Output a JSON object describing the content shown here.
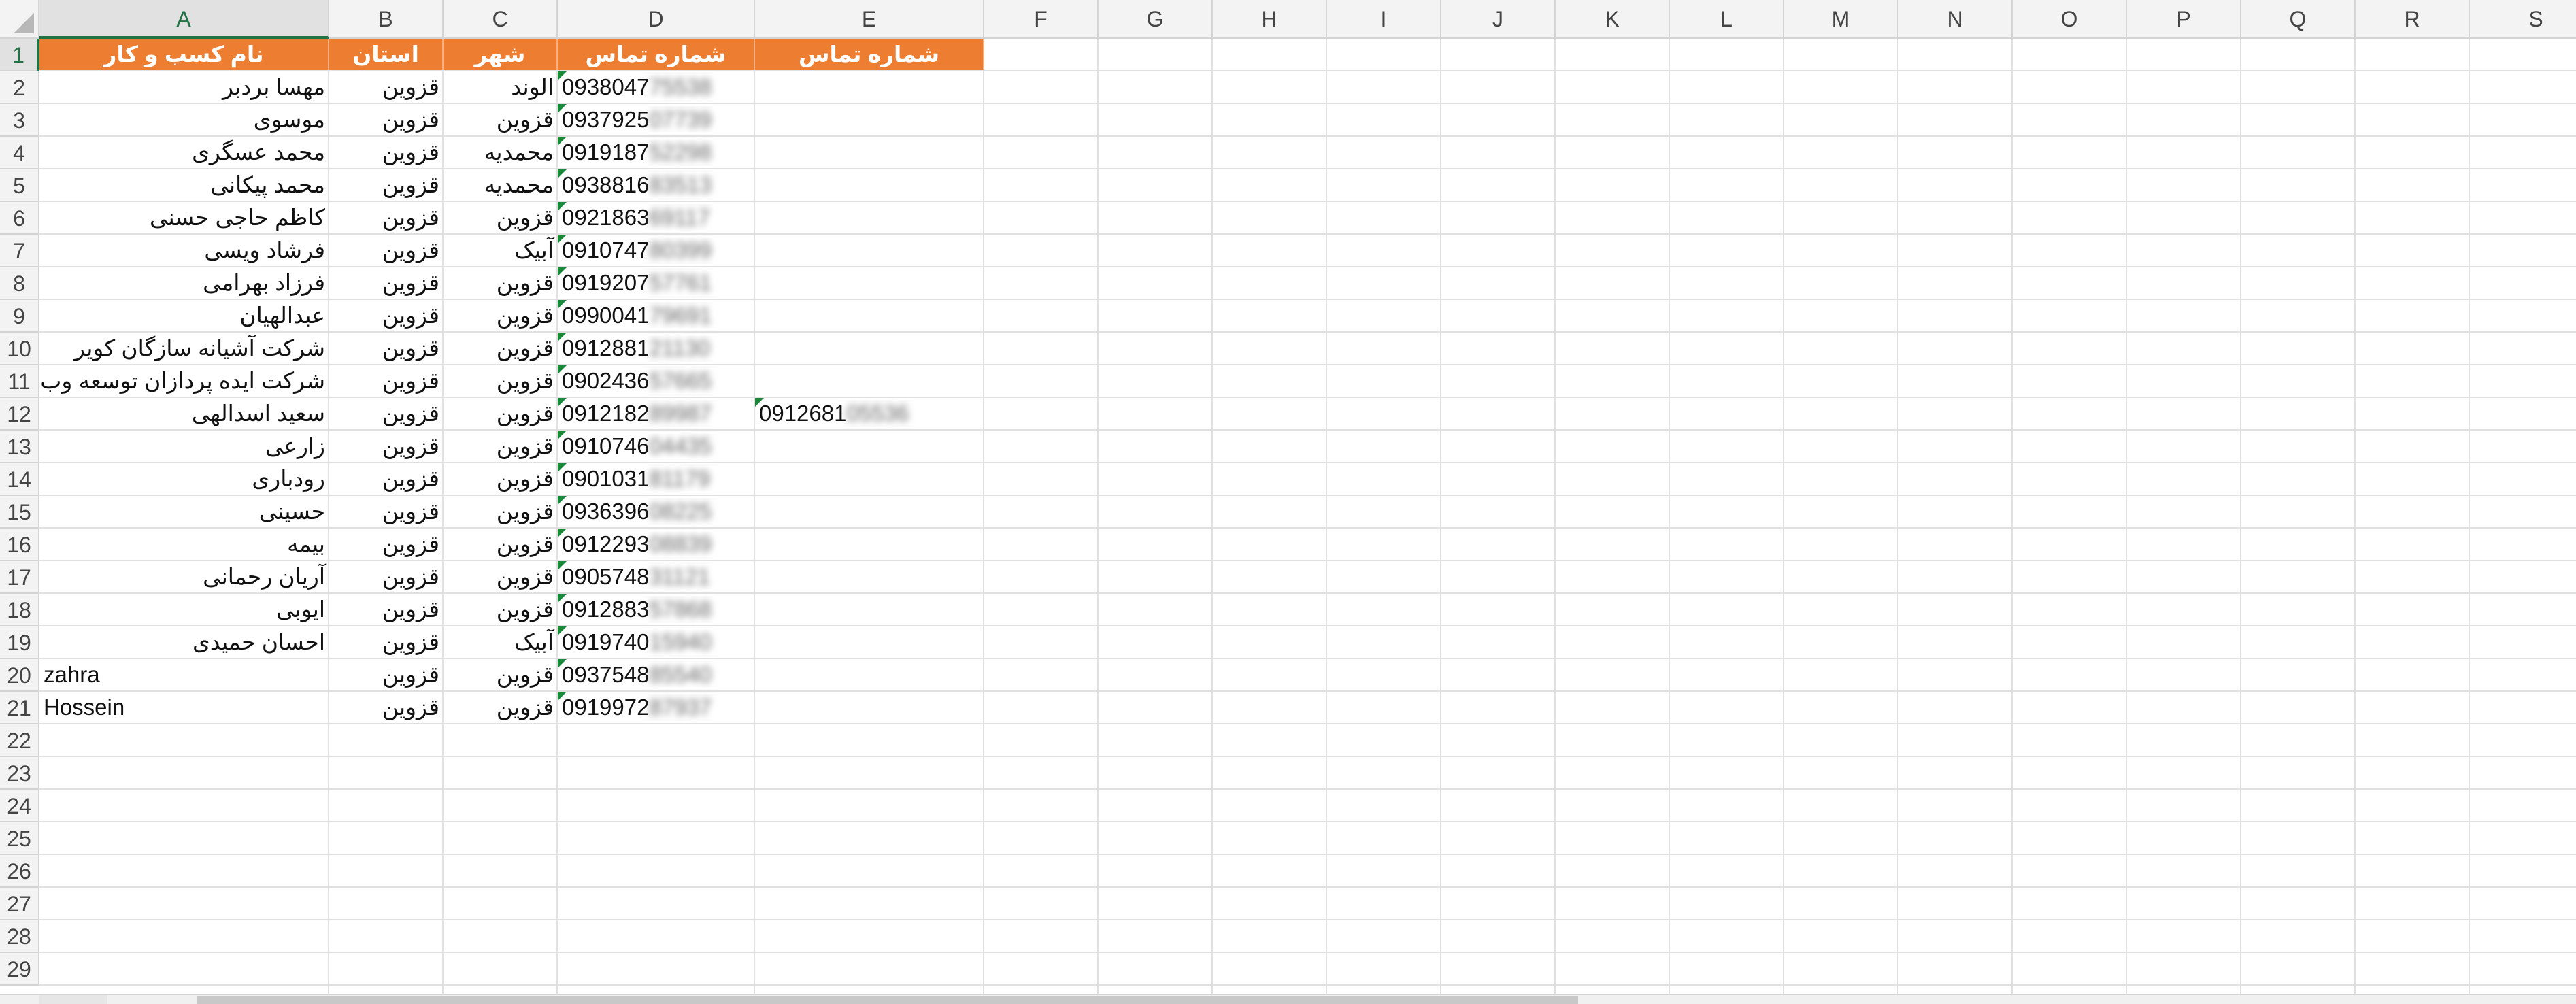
{
  "columns": [
    "A",
    "B",
    "C",
    "D",
    "E",
    "F",
    "G",
    "H",
    "I",
    "J",
    "K",
    "L",
    "M",
    "N",
    "O",
    "P",
    "Q",
    "R",
    "S"
  ],
  "row_numbers": [
    "1",
    "2",
    "3",
    "4",
    "5",
    "6",
    "7",
    "8",
    "9",
    "10",
    "11",
    "12",
    "13",
    "14",
    "15",
    "16",
    "17",
    "18",
    "19",
    "20",
    "21",
    "22",
    "23",
    "24",
    "25",
    "26",
    "27",
    "28",
    "29"
  ],
  "header_row": {
    "business_name": "نام کسب و کار",
    "province": "استان",
    "city": "شهر",
    "contact_number": "شماره تماس",
    "contact_number_2": "شماره تماس"
  },
  "rows": [
    {
      "name": "مهسا بردبر",
      "province": "قزوین",
      "city": "الوند",
      "phone_visible": "0938047",
      "phone_hidden": "75538",
      "phone2_visible": "",
      "phone2_hidden": ""
    },
    {
      "name": "موسوی",
      "province": "قزوین",
      "city": "قزوین",
      "phone_visible": "0937925",
      "phone_hidden": "07739",
      "phone2_visible": "",
      "phone2_hidden": ""
    },
    {
      "name": "محمد عسگری",
      "province": "قزوین",
      "city": "محمدیه",
      "phone_visible": "0919187",
      "phone_hidden": "52298",
      "phone2_visible": "",
      "phone2_hidden": ""
    },
    {
      "name": "محمد پیکانی",
      "province": "قزوین",
      "city": "محمدیه",
      "phone_visible": "0938816",
      "phone_hidden": "83513",
      "phone2_visible": "",
      "phone2_hidden": ""
    },
    {
      "name": "کاظم حاجی حسنی",
      "province": "قزوین",
      "city": "قزوین",
      "phone_visible": "0921863",
      "phone_hidden": "69117",
      "phone2_visible": "",
      "phone2_hidden": ""
    },
    {
      "name": "فرشاد ویسی",
      "province": "قزوین",
      "city": "آبیک",
      "phone_visible": "0910747",
      "phone_hidden": "80399",
      "phone2_visible": "",
      "phone2_hidden": ""
    },
    {
      "name": "فرزاد بهرامی",
      "province": "قزوین",
      "city": "قزوین",
      "phone_visible": "0919207",
      "phone_hidden": "57761",
      "phone2_visible": "",
      "phone2_hidden": ""
    },
    {
      "name": "عبدالهیان",
      "province": "قزوین",
      "city": "قزوین",
      "phone_visible": "0990041",
      "phone_hidden": "79691",
      "phone2_visible": "",
      "phone2_hidden": ""
    },
    {
      "name": "شرکت آشیانه سازگان کویر",
      "province": "قزوین",
      "city": "قزوین",
      "phone_visible": "0912881",
      "phone_hidden": "21130",
      "phone2_visible": "",
      "phone2_hidden": ""
    },
    {
      "name": "شرکت ایده پردازان توسعه وب",
      "province": "قزوین",
      "city": "قزوین",
      "phone_visible": "0902436",
      "phone_hidden": "57665",
      "phone2_visible": "",
      "phone2_hidden": ""
    },
    {
      "name": "سعید اسدالهی",
      "province": "قزوین",
      "city": "قزوین",
      "phone_visible": "0912182",
      "phone_hidden": "89987",
      "phone2_visible": "0912681",
      "phone2_hidden": "05536"
    },
    {
      "name": "زارعی",
      "province": "قزوین",
      "city": "قزوین",
      "phone_visible": "0910746",
      "phone_hidden": "04435",
      "phone2_visible": "",
      "phone2_hidden": ""
    },
    {
      "name": "رودباری",
      "province": "قزوین",
      "city": "قزوین",
      "phone_visible": "0901031",
      "phone_hidden": "81179",
      "phone2_visible": "",
      "phone2_hidden": ""
    },
    {
      "name": "حسینی",
      "province": "قزوین",
      "city": "قزوین",
      "phone_visible": "0936396",
      "phone_hidden": "08225",
      "phone2_visible": "",
      "phone2_hidden": ""
    },
    {
      "name": "بیمه",
      "province": "قزوین",
      "city": "قزوین",
      "phone_visible": "0912293",
      "phone_hidden": "08839",
      "phone2_visible": "",
      "phone2_hidden": ""
    },
    {
      "name": "آریان رحمانی",
      "province": "قزوین",
      "city": "قزوین",
      "phone_visible": "0905748",
      "phone_hidden": "31121",
      "phone2_visible": "",
      "phone2_hidden": ""
    },
    {
      "name": "ایوبی",
      "province": "قزوین",
      "city": "قزوین",
      "phone_visible": "0912883",
      "phone_hidden": "57868",
      "phone2_visible": "",
      "phone2_hidden": ""
    },
    {
      "name": "احسان حمیدی",
      "province": "قزوین",
      "city": "آبیک",
      "phone_visible": "0919740",
      "phone_hidden": "15940",
      "phone2_visible": "",
      "phone2_hidden": ""
    },
    {
      "name": "zahra",
      "province": "قزوین",
      "city": "قزوین",
      "phone_visible": "0937548",
      "phone_hidden": "85540",
      "phone2_visible": "",
      "phone2_hidden": ""
    },
    {
      "name": "Hossein",
      "province": "قزوین",
      "city": "قزوین",
      "phone_visible": "0919972",
      "phone_hidden": "87937",
      "phone2_visible": "",
      "phone2_hidden": ""
    }
  ],
  "colors": {
    "header_fill": "#ed7d31",
    "header_text": "#ffffff",
    "gridline": "#e1e1e1",
    "headings_bg": "#f3f3f3",
    "selection": "#217346",
    "error_flag": "#1a8a3a"
  }
}
